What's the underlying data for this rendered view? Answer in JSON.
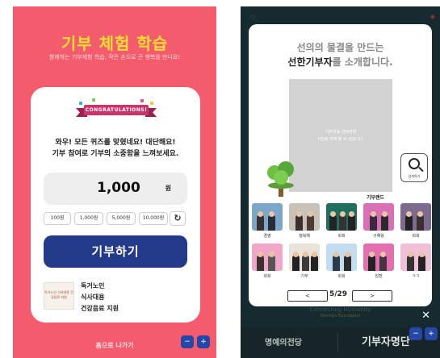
{
  "left": {
    "title": "기부 체험 학습",
    "subtitle": "함께하는 기부체험 학습, 작은 손으로 큰 행복을 만나요!",
    "banner": "CONGRATULATIONS!",
    "message_line1": "와우! 모든 퀴즈를 맞혔네요! 대단해요!",
    "message_line2": "기부 참여로 기부의 소중함을 느껴보세요.",
    "amount": "1,000",
    "amount_unit": "원",
    "chips": [
      "100원",
      "1,000원",
      "5,000원",
      "10,000원"
    ],
    "refresh_icon": "refresh-icon",
    "donate_label": "기부하기",
    "thumb_caption": "독거노인 식사대용 건강음료 지원",
    "campaign_lines": [
      "독거노인",
      "식사대용",
      "건강음료 지원"
    ],
    "home_label": "홈으로 나가기",
    "colors": {
      "background": "#f45c6e",
      "title": "#ffe032",
      "button": "#233a8a"
    }
  },
  "right": {
    "title_line1": "선의의 물결을 만드는",
    "title_highlight": "선한기부자",
    "title_rest": "를 소개합니다.",
    "photo_text_line1": "기부자를 선택하면",
    "photo_text_line2": "사진을 크게 볼 수 있습니다.",
    "search_label": "검색하기",
    "brand_label": "기부랜드",
    "donors_row1": [
      "경영",
      "행복해",
      "희희",
      "구해왕",
      "희희"
    ],
    "donors_row2": [
      "희희",
      "기부",
      "희희",
      "임환",
      "ㅋㅋ"
    ],
    "prev_label": "<",
    "next_label": ">",
    "page": "5/29",
    "close_label": "✕",
    "caption1": "Connecting Humanity",
    "caption2": "Shinhan Foundation",
    "tab_left": "명예의전당",
    "tab_right": "기부자명단",
    "colors": {
      "background": "#152b2f",
      "panel": "#ffffff"
    }
  }
}
